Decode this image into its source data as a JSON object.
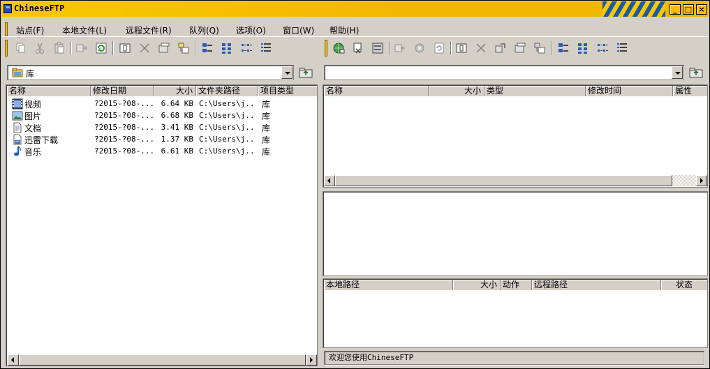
{
  "window": {
    "title": "ChineseFTP",
    "minimize": "_",
    "maximize": "□",
    "close": "×"
  },
  "menu": [
    "站点(F)",
    "本地文件(L)",
    "远程文件(R)",
    "队列(Q)",
    "选项(O)",
    "窗口(W)",
    "帮助(H)"
  ],
  "local": {
    "path": "库",
    "columns": [
      "名称",
      "修改日期",
      "大小",
      "文件夹路径",
      "项目类型"
    ],
    "files": [
      {
        "icon": "video-library-icon",
        "name": "视频",
        "modified": "?2015-?08-...",
        "size": "6.64 KB",
        "folder": "C:\\Users\\j...",
        "type": "库"
      },
      {
        "icon": "picture-library-icon",
        "name": "图片",
        "modified": "?2015-?08-...",
        "size": "6.68 KB",
        "folder": "C:\\Users\\j...",
        "type": "库"
      },
      {
        "icon": "document-library-icon",
        "name": "文档",
        "modified": "?2015-?08-...",
        "size": "3.41 KB",
        "folder": "C:\\Users\\j...",
        "type": "库"
      },
      {
        "icon": "download-library-icon",
        "name": "迅雷下载",
        "modified": "?2015-?08-...",
        "size": "1.37 KB",
        "folder": "C:\\Users\\j...",
        "type": "库"
      },
      {
        "icon": "music-library-icon",
        "name": "音乐",
        "modified": "?2015-?08-...",
        "size": "6.61 KB",
        "folder": "C:\\Users\\j...",
        "type": "库"
      }
    ]
  },
  "remote": {
    "path": "",
    "columns": [
      "名称",
      "大小",
      "类型",
      "修改时间",
      "属性"
    ]
  },
  "queue": {
    "columns": [
      "本地路径",
      "大小",
      "动作",
      "远程路径",
      "状态"
    ]
  },
  "status_text": "欢迎您使用ChineseFTP",
  "colors": {
    "title_bar": "#f0b800",
    "face": "#d4d0c8",
    "accent_blue": "#1a5aa8"
  }
}
